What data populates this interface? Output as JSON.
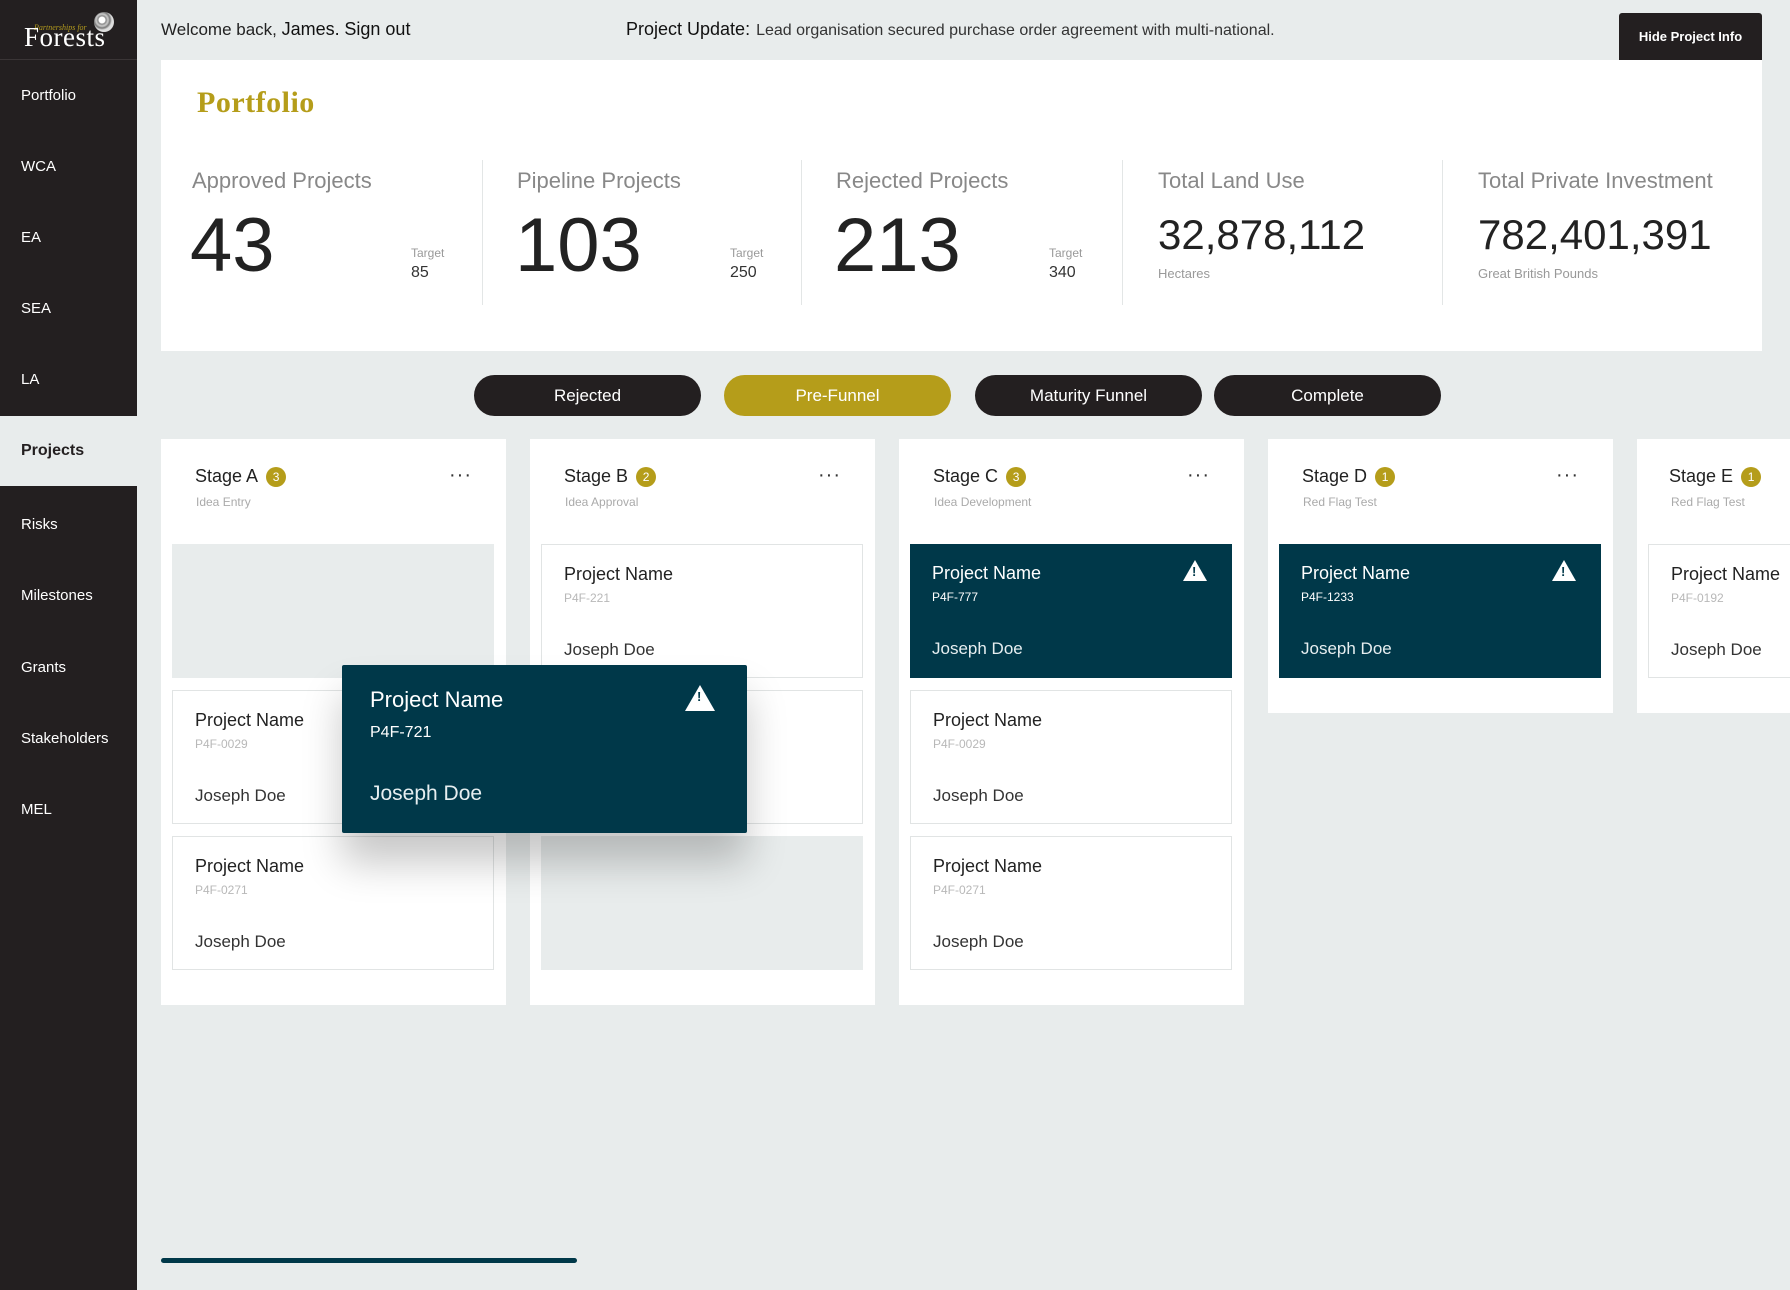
{
  "app": {
    "logo_small": "Partnerships for",
    "logo_main": "Forests"
  },
  "sidebar": {
    "items": [
      {
        "label": "Portfolio"
      },
      {
        "label": "WCA"
      },
      {
        "label": "EA"
      },
      {
        "label": "SEA"
      },
      {
        "label": "LA"
      },
      {
        "label": "Projects",
        "active": true
      },
      {
        "label": "Risks"
      },
      {
        "label": "Milestones"
      },
      {
        "label": "Grants"
      },
      {
        "label": "Stakeholders"
      },
      {
        "label": "MEL"
      }
    ]
  },
  "topbar": {
    "welcome_prefix": "Welcome back, ",
    "user_name": "James.",
    "sign_out": "Sign out",
    "update_label": "Project Update:",
    "update_text": "Lead organisation secured purchase order agreement with multi-national.",
    "hide_button": "Hide Project Info"
  },
  "portfolio": {
    "title": "Portfolio",
    "stats": [
      {
        "label": "Approved Projects",
        "value": "43",
        "target_label": "Target",
        "target": "85"
      },
      {
        "label": "Pipeline Projects",
        "value": "103",
        "target_label": "Target",
        "target": "250"
      },
      {
        "label": "Rejected Projects",
        "value": "213",
        "target_label": "Target",
        "target": "340"
      },
      {
        "label": "Total Land Use",
        "value": "32,878,112",
        "unit": "Hectares"
      },
      {
        "label": "Total Private Investment",
        "value": "782,401,391",
        "unit": "Great British Pounds"
      }
    ]
  },
  "filters": [
    {
      "label": "Rejected"
    },
    {
      "label": "Pre-Funnel",
      "active": true
    },
    {
      "label": "Maturity Funnel"
    },
    {
      "label": "Complete"
    }
  ],
  "columns": [
    {
      "title": "Stage A",
      "count": "3",
      "subtitle": "Idea Entry",
      "menu": "···",
      "cards": [
        {
          "placeholder": true
        },
        {
          "name": "Project Name",
          "id": "P4F-0029",
          "owner": "Joseph Doe"
        },
        {
          "name": "Project Name",
          "id": "P4F-0271",
          "owner": "Joseph Doe"
        }
      ]
    },
    {
      "title": "Stage B",
      "count": "2",
      "subtitle": "Idea Approval",
      "menu": "···",
      "cards": [
        {
          "name": "Project Name",
          "id": "P4F-221",
          "owner": "Joseph Doe"
        },
        {
          "name": "",
          "id": "",
          "owner": ""
        },
        {
          "placeholder": true
        }
      ]
    },
    {
      "title": "Stage C",
      "count": "3",
      "subtitle": "Idea Development",
      "menu": "···",
      "cards": [
        {
          "name": "Project Name",
          "id": "P4F-777",
          "owner": "Joseph Doe",
          "alert": true
        },
        {
          "name": "Project Name",
          "id": "P4F-0029",
          "owner": "Joseph Doe"
        },
        {
          "name": "Project Name",
          "id": "P4F-0271",
          "owner": "Joseph Doe"
        }
      ]
    },
    {
      "title": "Stage D",
      "count": "1",
      "subtitle": "Red Flag Test",
      "menu": "···",
      "cards": [
        {
          "name": "Project Name",
          "id": "P4F-1233",
          "owner": "Joseph Doe",
          "alert": true
        }
      ]
    },
    {
      "title": "Stage E",
      "count": "1",
      "subtitle": "Red Flag Test",
      "cards": [
        {
          "name": "Project Name",
          "id": "P4F-0192",
          "owner": "Joseph Doe"
        }
      ]
    }
  ],
  "dragged_card": {
    "name": "Project Name",
    "id": "P4F-721",
    "owner": "Joseph Doe",
    "alert": true
  },
  "scrollbar": {
    "position": 0.26
  },
  "colors": {
    "accent": "#b59d1a",
    "dark_card": "#003849",
    "sidebar": "#231f20",
    "background": "#e8ecec"
  }
}
